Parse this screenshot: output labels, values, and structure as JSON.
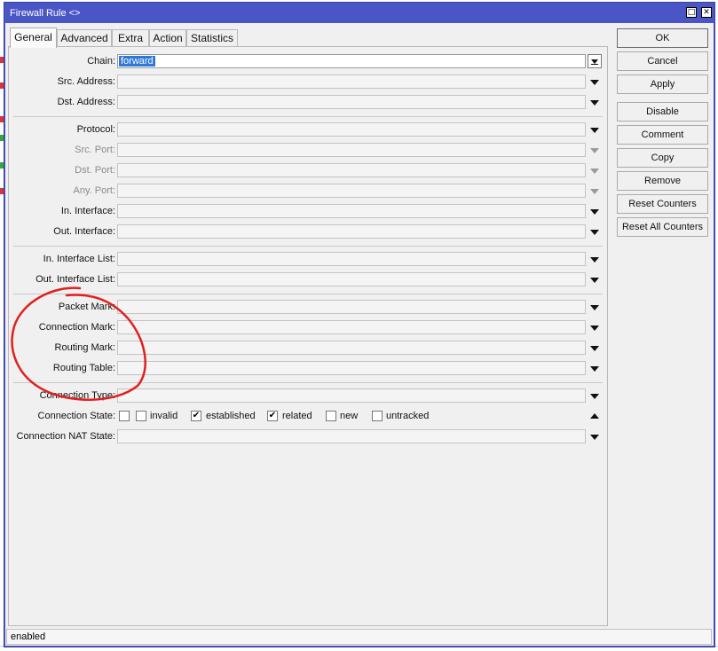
{
  "window": {
    "title": "Firewall Rule <>"
  },
  "titlebar_buttons": {
    "restore": "□",
    "close": "✕"
  },
  "tabs": [
    {
      "label": "General",
      "active": true
    },
    {
      "label": "Advanced"
    },
    {
      "label": "Extra"
    },
    {
      "label": "Action"
    },
    {
      "label": "Statistics"
    }
  ],
  "fields": {
    "chain": {
      "label": "Chain:",
      "value": "forward"
    },
    "src_address": {
      "label": "Src. Address:"
    },
    "dst_address": {
      "label": "Dst. Address:"
    },
    "protocol": {
      "label": "Protocol:"
    },
    "src_port": {
      "label": "Src. Port:",
      "disabled": true
    },
    "dst_port": {
      "label": "Dst. Port:",
      "disabled": true
    },
    "any_port": {
      "label": "Any. Port:",
      "disabled": true
    },
    "in_interface": {
      "label": "In. Interface:"
    },
    "out_interface": {
      "label": "Out. Interface:"
    },
    "in_interface_list": {
      "label": "In. Interface List:"
    },
    "out_interface_list": {
      "label": "Out. Interface List:"
    },
    "packet_mark": {
      "label": "Packet Mark:"
    },
    "connection_mark": {
      "label": "Connection Mark:"
    },
    "routing_mark": {
      "label": "Routing Mark:"
    },
    "routing_table": {
      "label": "Routing Table:"
    },
    "connection_type": {
      "label": "Connection Type:"
    },
    "connection_state": {
      "label": "Connection State:",
      "options": [
        {
          "label": "invalid",
          "checked": false
        },
        {
          "label": "established",
          "checked": true
        },
        {
          "label": "related",
          "checked": true
        },
        {
          "label": "new",
          "checked": false
        },
        {
          "label": "untracked",
          "checked": false
        }
      ]
    },
    "connection_nat_state": {
      "label": "Connection NAT State:"
    }
  },
  "buttons": {
    "ok": "OK",
    "cancel": "Cancel",
    "apply": "Apply",
    "disable": "Disable",
    "comment": "Comment",
    "copy": "Copy",
    "remove": "Remove",
    "reset_counters": "Reset Counters",
    "reset_all_counters": "Reset All Counters"
  },
  "status": {
    "text": "enabled"
  },
  "colors": {
    "title_bar": "#4b56c6",
    "selection": "#3078d8",
    "annotation": "#e02020"
  },
  "check_glyph": "✔"
}
